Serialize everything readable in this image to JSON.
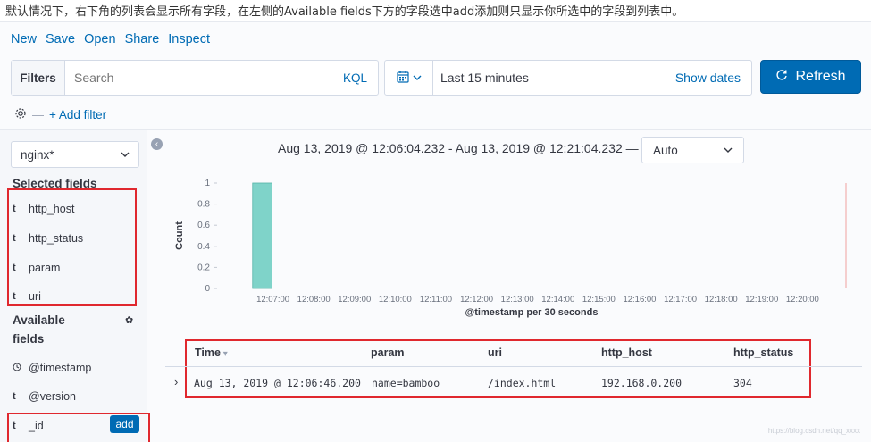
{
  "caption": "默认情况下，右下角的列表会显示所有字段，在左侧的Available fields下方的字段选中add添加则只显示你所选中的字段到列表中。",
  "topnav": [
    "New",
    "Save",
    "Open",
    "Share",
    "Inspect"
  ],
  "filterbar": {
    "label": "Filters",
    "placeholder": "Search",
    "kql": "KQL"
  },
  "datebar": {
    "range": "Last 15 minutes",
    "show_dates": "Show dates"
  },
  "refresh": {
    "label": "Refresh",
    "icon": "refresh-icon"
  },
  "add_filter": "+ Add filter",
  "index_pattern": "nginx*",
  "selected_fields_title": "Selected fields",
  "selected_fields": [
    {
      "type": "t",
      "name": "http_host"
    },
    {
      "type": "t",
      "name": "http_status"
    },
    {
      "type": "t",
      "name": "param"
    },
    {
      "type": "t",
      "name": "uri"
    }
  ],
  "available_fields_title": [
    "Available",
    "fields"
  ],
  "available_fields": [
    {
      "type": "clock",
      "name": "@timestamp"
    },
    {
      "type": "t",
      "name": "@version"
    },
    {
      "type": "t",
      "name": "_id"
    }
  ],
  "add_label": "add",
  "time_title": "Aug 13, 2019 @ 12:06:04.232 - Aug 13, 2019 @ 12:21:04.232 —",
  "interval": "Auto",
  "chart_data": {
    "type": "bar",
    "ylabel": "Count",
    "xlabel": "@timestamp per 30 seconds",
    "ylim": [
      0,
      1
    ],
    "yticks": [
      "0",
      "0.2",
      "0.4",
      "0.6",
      "0.8",
      "1"
    ],
    "categories": [
      "12:07:00",
      "12:08:00",
      "12:09:00",
      "12:10:00",
      "12:11:00",
      "12:12:00",
      "12:13:00",
      "12:14:00",
      "12:15:00",
      "12:16:00",
      "12:17:00",
      "12:18:00",
      "12:19:00",
      "12:20:00"
    ],
    "bars": [
      {
        "x": "12:06:30",
        "value": 1
      }
    ],
    "bar_color": "#7fd3c9"
  },
  "table": {
    "headers": [
      "Time",
      "param",
      "uri",
      "http_host",
      "http_status"
    ],
    "rows": [
      [
        "Aug 13, 2019 @ 12:06:46.200",
        "name=bamboo",
        "/index.html",
        "192.168.0.200",
        "304"
      ]
    ]
  },
  "watermark": "https://blog.csdn.net/qq_xxxx"
}
